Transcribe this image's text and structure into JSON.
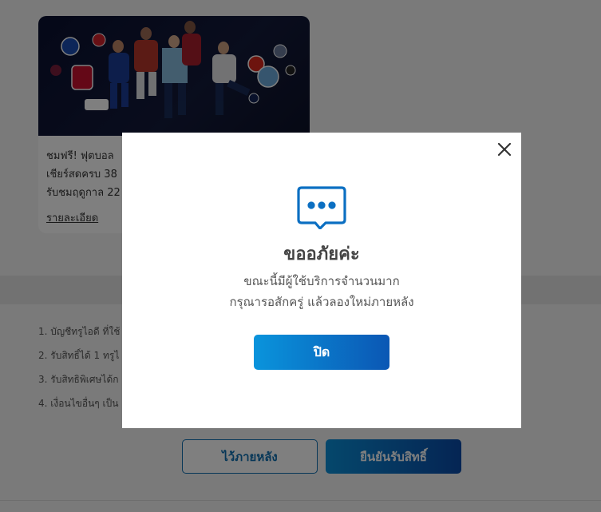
{
  "card": {
    "banner_image": "football-players-promo-banner",
    "text_line1": "ชมฟรี! ฟุตบอล",
    "text_line2": "เชียร์สดครบ 38",
    "text_line3": "รับชมฤดูกาล 22",
    "details_link": "รายละเอียด"
  },
  "terms": [
    "1. บัญชีทรูไอดี ที่ใช้",
    "2. รับสิทธิ์ได้ 1 ทรูไ",
    "3. รับสิทธิพิเศษได้ก",
    "4. เงื่อนไขอื่นๆ เป็น"
  ],
  "actions": {
    "later_label": "ไว้ภายหลัง",
    "confirm_label": "ยืนยันรับสิทธิ์"
  },
  "modal": {
    "icon": "chat-bubble-icon",
    "title": "ขออภัยค่ะ",
    "line1": "ขณะนี้มีผู้ใช้บริการจำนวนมาก",
    "line2": "กรุณารอสักครู่ แล้วลองใหม่ภายหลัง",
    "close_button_label": "ปิด"
  },
  "colors": {
    "accent": "#0b6fc2",
    "overlay": "rgba(0,0,0,0.5)"
  }
}
